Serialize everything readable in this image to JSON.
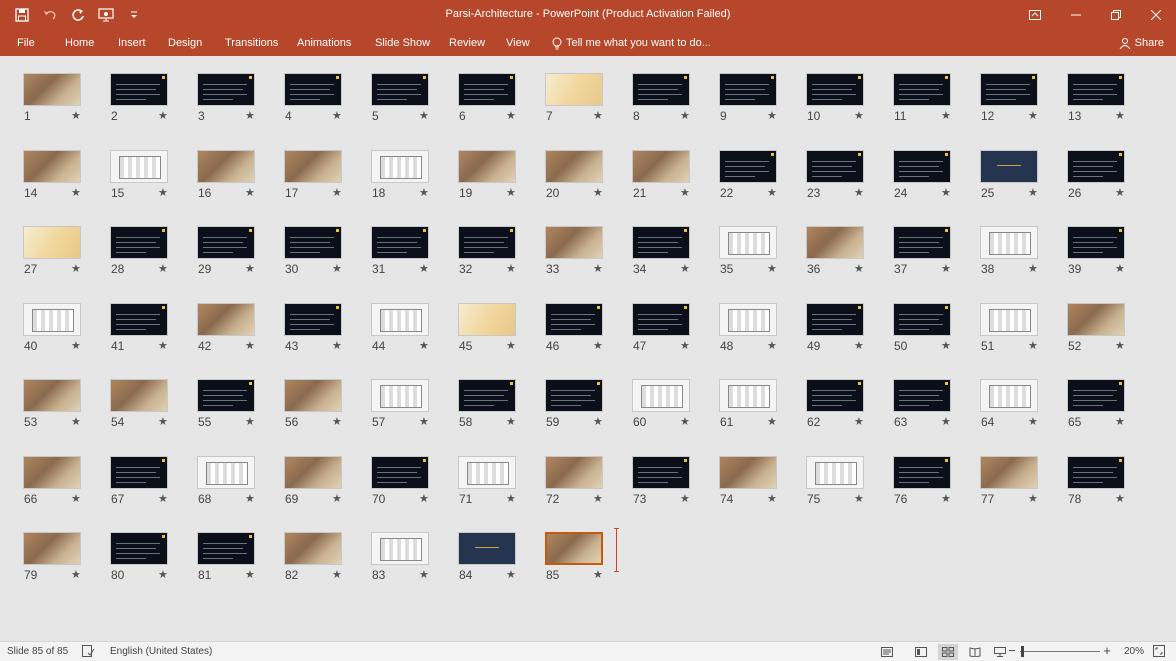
{
  "titlebar": {
    "title": "Parsi-Architecture - PowerPoint (Product Activation Failed)",
    "icons": [
      "save-icon",
      "undo-icon",
      "redo-icon",
      "start-from-beginning-icon",
      "customize-qat-icon"
    ],
    "colors": {
      "brand": "#b7472a"
    }
  },
  "tabs": {
    "file": "File",
    "home": "Home",
    "insert": "Insert",
    "design": "Design",
    "transitions": "Transitions",
    "animations": "Animations",
    "slideshow": "Slide Show",
    "review": "Review",
    "view": "View",
    "tell": "Tell me what you want to do...",
    "share": "Share"
  },
  "slides": [
    {
      "n": "1",
      "t": "photo"
    },
    {
      "n": "2",
      "t": "dark"
    },
    {
      "n": "3",
      "t": "dark"
    },
    {
      "n": "4",
      "t": "dark"
    },
    {
      "n": "5",
      "t": "dark"
    },
    {
      "n": "6",
      "t": "dark"
    },
    {
      "n": "7",
      "t": "map"
    },
    {
      "n": "8",
      "t": "dark"
    },
    {
      "n": "9",
      "t": "dark"
    },
    {
      "n": "10",
      "t": "dark"
    },
    {
      "n": "11",
      "t": "dark"
    },
    {
      "n": "12",
      "t": "dark"
    },
    {
      "n": "13",
      "t": "dark"
    },
    {
      "n": "14",
      "t": "photo"
    },
    {
      "n": "15",
      "t": "light"
    },
    {
      "n": "16",
      "t": "photo"
    },
    {
      "n": "17",
      "t": "photo"
    },
    {
      "n": "18",
      "t": "light"
    },
    {
      "n": "19",
      "t": "photo"
    },
    {
      "n": "20",
      "t": "photo"
    },
    {
      "n": "21",
      "t": "photo"
    },
    {
      "n": "22",
      "t": "dark"
    },
    {
      "n": "23",
      "t": "dark"
    },
    {
      "n": "24",
      "t": "dark"
    },
    {
      "n": "25",
      "t": "navy"
    },
    {
      "n": "26",
      "t": "dark"
    },
    {
      "n": "27",
      "t": "map"
    },
    {
      "n": "28",
      "t": "dark"
    },
    {
      "n": "29",
      "t": "dark"
    },
    {
      "n": "30",
      "t": "dark"
    },
    {
      "n": "31",
      "t": "dark"
    },
    {
      "n": "32",
      "t": "dark"
    },
    {
      "n": "33",
      "t": "photo"
    },
    {
      "n": "34",
      "t": "dark"
    },
    {
      "n": "35",
      "t": "light"
    },
    {
      "n": "36",
      "t": "photo"
    },
    {
      "n": "37",
      "t": "dark"
    },
    {
      "n": "38",
      "t": "light"
    },
    {
      "n": "39",
      "t": "dark"
    },
    {
      "n": "40",
      "t": "light"
    },
    {
      "n": "41",
      "t": "dark"
    },
    {
      "n": "42",
      "t": "photo"
    },
    {
      "n": "43",
      "t": "dark"
    },
    {
      "n": "44",
      "t": "light"
    },
    {
      "n": "45",
      "t": "map"
    },
    {
      "n": "46",
      "t": "dark"
    },
    {
      "n": "47",
      "t": "dark"
    },
    {
      "n": "48",
      "t": "light"
    },
    {
      "n": "49",
      "t": "dark"
    },
    {
      "n": "50",
      "t": "dark"
    },
    {
      "n": "51",
      "t": "light"
    },
    {
      "n": "52",
      "t": "photo"
    },
    {
      "n": "53",
      "t": "photo"
    },
    {
      "n": "54",
      "t": "photo"
    },
    {
      "n": "55",
      "t": "dark"
    },
    {
      "n": "56",
      "t": "photo"
    },
    {
      "n": "57",
      "t": "light"
    },
    {
      "n": "58",
      "t": "dark"
    },
    {
      "n": "59",
      "t": "dark"
    },
    {
      "n": "60",
      "t": "light"
    },
    {
      "n": "61",
      "t": "light"
    },
    {
      "n": "62",
      "t": "dark"
    },
    {
      "n": "63",
      "t": "dark"
    },
    {
      "n": "64",
      "t": "light"
    },
    {
      "n": "65",
      "t": "dark"
    },
    {
      "n": "66",
      "t": "photo"
    },
    {
      "n": "67",
      "t": "dark"
    },
    {
      "n": "68",
      "t": "light"
    },
    {
      "n": "69",
      "t": "photo"
    },
    {
      "n": "70",
      "t": "dark"
    },
    {
      "n": "71",
      "t": "light"
    },
    {
      "n": "72",
      "t": "photo"
    },
    {
      "n": "73",
      "t": "dark"
    },
    {
      "n": "74",
      "t": "photo"
    },
    {
      "n": "75",
      "t": "light"
    },
    {
      "n": "76",
      "t": "dark"
    },
    {
      "n": "77",
      "t": "photo"
    },
    {
      "n": "78",
      "t": "dark"
    },
    {
      "n": "79",
      "t": "photo"
    },
    {
      "n": "80",
      "t": "dark"
    },
    {
      "n": "81",
      "t": "dark"
    },
    {
      "n": "82",
      "t": "photo"
    },
    {
      "n": "83",
      "t": "light"
    },
    {
      "n": "84",
      "t": "navy"
    },
    {
      "n": "85",
      "t": "photo"
    }
  ],
  "selected_slide": "85",
  "status": {
    "slide": "Slide 85 of 85",
    "language": "English (United States)",
    "zoom": "20%",
    "zoom_level": 0.2
  }
}
